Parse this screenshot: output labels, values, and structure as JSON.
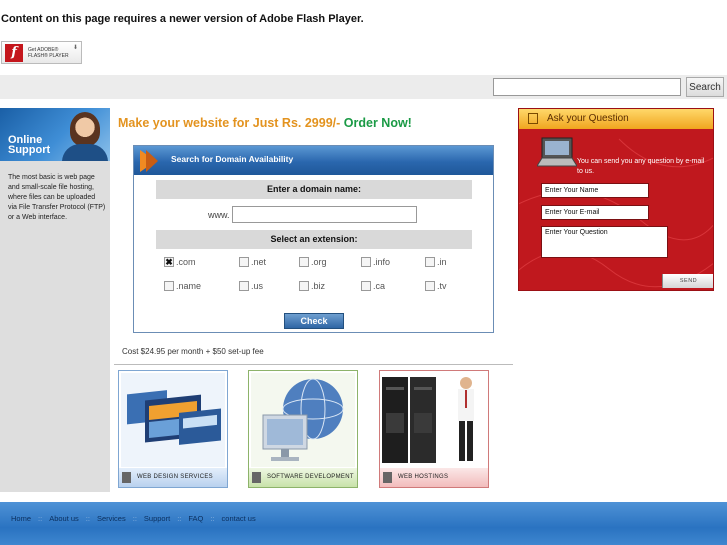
{
  "flash": {
    "message": "Content on this page requires a newer version of Adobe Flash Player.",
    "badge_line1": "Get ADOBE®",
    "badge_line2": "FLASH® PLAYER",
    "badge_icon": "flash-logo-icon"
  },
  "search": {
    "value": "",
    "button_label": "Search"
  },
  "sidebar": {
    "support_title_1": "Online",
    "support_title_2": "Support",
    "description": "The most basic is web page and small-scale file hosting, where files can be uploaded via File Transfer Protocol (FTP) or a Web interface."
  },
  "promo": {
    "text": "Make your website for Just Rs. 2999/- ",
    "cta": "Order Now!"
  },
  "domain": {
    "header": "Search for Domain Availability",
    "enter_label": "Enter a domain name:",
    "www_label": "www.",
    "domain_value": "",
    "extension_label": "Select an extension:",
    "extensions": [
      {
        "label": ".com",
        "checked": true
      },
      {
        "label": ".net",
        "checked": false
      },
      {
        "label": ".org",
        "checked": false
      },
      {
        "label": ".info",
        "checked": false
      },
      {
        "label": ".in",
        "checked": false
      },
      {
        "label": ".name",
        "checked": false
      },
      {
        "label": ".us",
        "checked": false
      },
      {
        "label": ".biz",
        "checked": false
      },
      {
        "label": ".ca",
        "checked": false
      },
      {
        "label": ".tv",
        "checked": false
      }
    ],
    "check_button": "Check"
  },
  "cost": "Cost $24.95 per month + $50 set-up fee",
  "services": [
    {
      "label": "Web Design Services"
    },
    {
      "label": "Software Development"
    },
    {
      "label": "Web Hostings"
    }
  ],
  "ask": {
    "title": "Ask your Question",
    "info": "You can send you any question by e-mail to us.",
    "name_value": "Enter Your Name",
    "email_value": "Enter Your E-mail",
    "question_value": "Enter Your Question",
    "send_label": "SEND"
  },
  "footer": {
    "links": [
      "Home",
      "About us",
      "Services",
      "Support",
      "FAQ",
      "contact us"
    ],
    "separator": "::"
  },
  "colors": {
    "promo_orange": "#e3931f",
    "promo_green": "#1a9a45",
    "ask_red": "#c0181e",
    "footer_blue": "#2a73c1",
    "header_blue": "#2a67ae"
  }
}
